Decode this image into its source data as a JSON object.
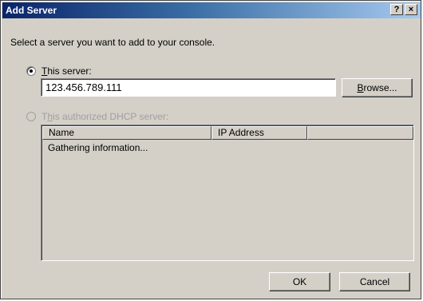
{
  "window": {
    "title": "Add Server",
    "help_label": "?",
    "close_label": "×"
  },
  "instruction": "Select a server you want to add to your console.",
  "this_server": {
    "label_prefix": "T",
    "label_rest": "his server:",
    "selected": true,
    "value": "123.456.789.111"
  },
  "browse_button": {
    "label_prefix": "B",
    "label_rest": "rowse..."
  },
  "dhcp_server": {
    "label_first": "T",
    "label_accel": "h",
    "label_rest": "is authorized DHCP server:",
    "selected": false,
    "enabled": false
  },
  "server_list": {
    "columns": [
      "Name",
      "IP Address",
      ""
    ],
    "status_row": "Gathering information..."
  },
  "footer": {
    "ok_label": "OK",
    "cancel_label": "Cancel"
  },
  "colors": {
    "dialog_face": "#d4d0c8",
    "titlebar_start": "#0a246a",
    "titlebar_end": "#a6caf0",
    "disabled_text": "#a0a0a0"
  }
}
